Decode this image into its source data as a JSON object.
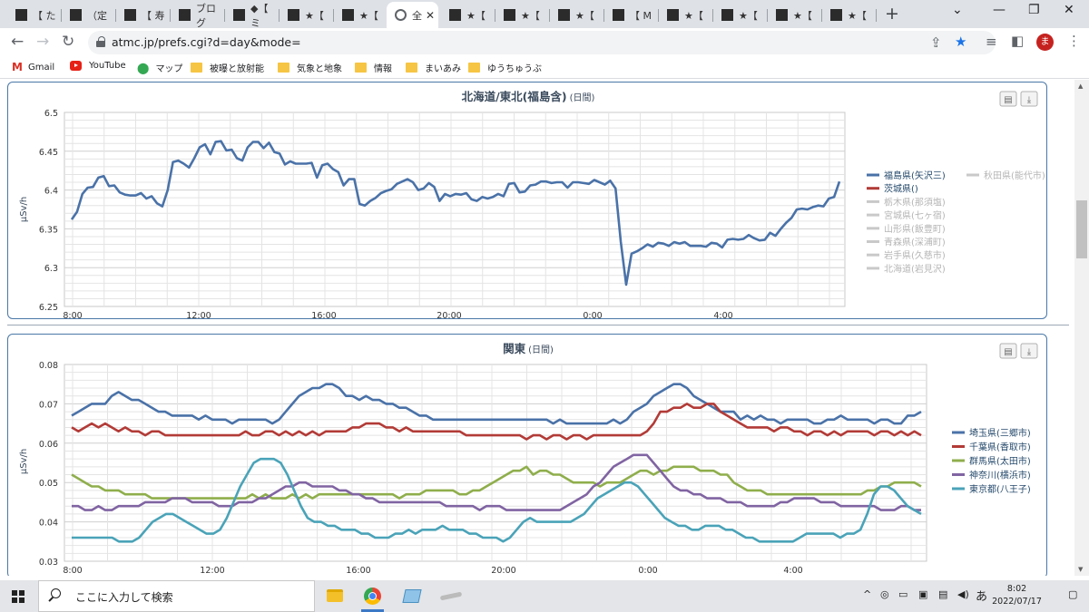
{
  "browser": {
    "tabs": [
      {
        "label": "【 た",
        "active": false
      },
      {
        "label": "（定",
        "active": false
      },
      {
        "label": "【 寿",
        "active": false
      },
      {
        "label": "ブログ",
        "active": false
      },
      {
        "label": "◆【 ミ",
        "active": false
      },
      {
        "label": "★【",
        "active": false
      },
      {
        "label": "★【",
        "active": false
      },
      {
        "label": "全",
        "active": true
      },
      {
        "label": "★【",
        "active": false
      },
      {
        "label": "★【",
        "active": false
      },
      {
        "label": "★【",
        "active": false
      },
      {
        "label": "【 M",
        "active": false
      },
      {
        "label": "★【",
        "active": false
      },
      {
        "label": "★【",
        "active": false
      },
      {
        "label": "★【",
        "active": false
      },
      {
        "label": "★【",
        "active": false
      }
    ],
    "url": "atmc.jp/prefs.cgi?d=day&mode=",
    "profile_initial": "ま",
    "bookmarks": [
      {
        "label": "Gmail",
        "icon": "gmail-icon"
      },
      {
        "label": "YouTube",
        "icon": "youtube-icon"
      },
      {
        "label": "マップ",
        "icon": "maps-icon"
      },
      {
        "label": "被曝と放射能",
        "icon": "folder-icon"
      },
      {
        "label": "気象と地象",
        "icon": "folder-icon"
      },
      {
        "label": "情報",
        "icon": "folder-icon"
      },
      {
        "label": "まいあみ",
        "icon": "folder-icon"
      },
      {
        "label": "ゆうちゅうぶ",
        "icon": "folder-icon"
      }
    ]
  },
  "taskbar": {
    "search_placeholder": "ここに入力して検索",
    "time": "8:02",
    "date": "2022/07/17",
    "ime": "あ"
  },
  "chart_data": [
    {
      "type": "line",
      "title": "北海道/東北(福島含)",
      "subtitle": "(日間)",
      "ylabel": "μSv/h",
      "ylim": [
        6.25,
        6.5
      ],
      "yticks": [
        "6.5",
        "6.45",
        "6.4",
        "6.35",
        "6.3",
        "6.25"
      ],
      "xticks": [
        "8:00",
        "12:00",
        "16:00",
        "20:00",
        "0:00",
        "4:00"
      ],
      "grid": true,
      "legend_position": "right",
      "series": [
        {
          "name": "福島県(矢沢三)",
          "color": "#4a72a8",
          "active": true,
          "values": [
            6.362,
            6.372,
            6.395,
            6.403,
            6.404,
            6.416,
            6.418,
            6.405,
            6.406,
            6.397,
            6.394,
            6.393,
            6.393,
            6.396,
            6.389,
            6.392,
            6.383,
            6.379,
            6.4,
            6.436,
            6.438,
            6.434,
            6.429,
            6.441,
            6.455,
            6.459,
            6.446,
            6.462,
            6.463,
            6.451,
            6.452,
            6.441,
            6.438,
            6.455,
            6.462,
            6.462,
            6.454,
            6.461,
            6.449,
            6.447,
            6.433,
            6.437,
            6.434,
            6.434,
            6.434,
            6.435,
            6.416,
            6.432,
            6.434,
            6.427,
            6.423,
            6.406,
            6.414,
            6.414,
            6.382,
            6.38,
            6.386,
            6.39,
            6.396,
            6.399,
            6.401,
            6.408,
            6.411,
            6.414,
            6.41,
            6.4,
            6.402,
            6.409,
            6.404,
            6.386,
            6.395,
            6.392,
            6.395,
            6.394,
            6.396,
            6.388,
            6.386,
            6.391,
            6.389,
            6.391,
            6.395,
            6.392,
            6.408,
            6.409,
            6.397,
            6.398,
            6.406,
            6.407,
            6.411,
            6.411,
            6.409,
            6.41,
            6.41,
            6.403,
            6.41,
            6.41,
            6.409,
            6.408,
            6.413,
            6.41,
            6.407,
            6.412,
            6.402,
            6.333,
            6.278,
            6.318,
            6.321,
            6.325,
            6.33,
            6.327,
            6.332,
            6.331,
            6.328,
            6.333,
            6.331,
            6.333,
            6.328,
            6.328,
            6.328,
            6.327,
            6.332,
            6.331,
            6.326,
            6.336,
            6.337,
            6.336,
            6.337,
            6.342,
            6.338,
            6.335,
            6.336,
            6.345,
            6.341,
            6.35,
            6.358,
            6.364,
            6.375,
            6.376,
            6.375,
            6.378,
            6.38,
            6.379,
            6.389,
            6.391,
            6.411
          ]
        },
        {
          "name": "秋田県(能代市)",
          "color": "#c9c9c9",
          "active": false,
          "values": []
        },
        {
          "name": "茨城県()",
          "color": "#b23b37",
          "active": true,
          "values": []
        },
        {
          "name": "栃木県(那須塩)",
          "color": "#c9c9c9",
          "active": false,
          "values": []
        },
        {
          "name": "宮城県(七ヶ宿)",
          "color": "#c9c9c9",
          "active": false,
          "values": []
        },
        {
          "name": "山形県(飯豊町)",
          "color": "#c9c9c9",
          "active": false,
          "values": []
        },
        {
          "name": "青森県(深浦町)",
          "color": "#c9c9c9",
          "active": false,
          "values": []
        },
        {
          "name": "岩手県(久慈市)",
          "color": "#c9c9c9",
          "active": false,
          "values": []
        },
        {
          "name": "北海道(岩見沢)",
          "color": "#c9c9c9",
          "active": false,
          "values": []
        }
      ]
    },
    {
      "type": "line",
      "title": "関東",
      "subtitle": "(日間)",
      "ylabel": "μSv/h",
      "ylim": [
        0.03,
        0.08
      ],
      "yticks": [
        "0.08",
        "0.07",
        "0.06",
        "0.05",
        "0.04",
        "0.03"
      ],
      "xticks": [
        "8:00",
        "12:00",
        "16:00",
        "20:00",
        "0:00",
        "4:00"
      ],
      "grid": true,
      "legend_position": "right",
      "series": [
        {
          "name": "埼玉県(三郷市)",
          "color": "#4a72a8",
          "active": true,
          "values": [
            0.067,
            0.068,
            0.069,
            0.07,
            0.07,
            0.07,
            0.072,
            0.073,
            0.072,
            0.071,
            0.071,
            0.07,
            0.069,
            0.068,
            0.068,
            0.067,
            0.067,
            0.067,
            0.067,
            0.066,
            0.067,
            0.066,
            0.066,
            0.066,
            0.065,
            0.066,
            0.066,
            0.066,
            0.066,
            0.066,
            0.065,
            0.066,
            0.068,
            0.07,
            0.072,
            0.073,
            0.074,
            0.074,
            0.075,
            0.075,
            0.074,
            0.072,
            0.072,
            0.071,
            0.072,
            0.071,
            0.071,
            0.07,
            0.07,
            0.069,
            0.069,
            0.068,
            0.067,
            0.067,
            0.066,
            0.066,
            0.066,
            0.066,
            0.066,
            0.066,
            0.066,
            0.066,
            0.066,
            0.066,
            0.066,
            0.066,
            0.066,
            0.066,
            0.066,
            0.066,
            0.066,
            0.066,
            0.065,
            0.066,
            0.065,
            0.065,
            0.065,
            0.065,
            0.065,
            0.065,
            0.065,
            0.066,
            0.065,
            0.066,
            0.068,
            0.069,
            0.07,
            0.072,
            0.073,
            0.074,
            0.075,
            0.075,
            0.074,
            0.072,
            0.071,
            0.07,
            0.069,
            0.068,
            0.068,
            0.068,
            0.066,
            0.067,
            0.066,
            0.067,
            0.066,
            0.066,
            0.065,
            0.066,
            0.066,
            0.066,
            0.066,
            0.065,
            0.065,
            0.066,
            0.066,
            0.067,
            0.066,
            0.066,
            0.066,
            0.066,
            0.065,
            0.066,
            0.066,
            0.065,
            0.065,
            0.067,
            0.067,
            0.068
          ]
        },
        {
          "name": "千葉県(香取市)",
          "color": "#b23b37",
          "active": true,
          "values": [
            0.064,
            0.063,
            0.064,
            0.065,
            0.064,
            0.065,
            0.064,
            0.063,
            0.064,
            0.063,
            0.063,
            0.062,
            0.063,
            0.063,
            0.062,
            0.062,
            0.062,
            0.062,
            0.062,
            0.062,
            0.062,
            0.062,
            0.062,
            0.062,
            0.062,
            0.062,
            0.063,
            0.062,
            0.062,
            0.063,
            0.063,
            0.062,
            0.063,
            0.062,
            0.063,
            0.062,
            0.063,
            0.062,
            0.063,
            0.063,
            0.063,
            0.063,
            0.064,
            0.064,
            0.065,
            0.065,
            0.065,
            0.064,
            0.064,
            0.063,
            0.064,
            0.063,
            0.063,
            0.063,
            0.063,
            0.063,
            0.063,
            0.063,
            0.063,
            0.062,
            0.062,
            0.062,
            0.062,
            0.062,
            0.062,
            0.062,
            0.062,
            0.062,
            0.061,
            0.062,
            0.062,
            0.061,
            0.062,
            0.062,
            0.061,
            0.062,
            0.062,
            0.061,
            0.062,
            0.062,
            0.062,
            0.062,
            0.062,
            0.062,
            0.062,
            0.062,
            0.063,
            0.065,
            0.068,
            0.068,
            0.069,
            0.069,
            0.07,
            0.069,
            0.069,
            0.07,
            0.07,
            0.068,
            0.067,
            0.066,
            0.065,
            0.064,
            0.064,
            0.064,
            0.064,
            0.063,
            0.064,
            0.064,
            0.063,
            0.063,
            0.062,
            0.063,
            0.063,
            0.062,
            0.063,
            0.062,
            0.063,
            0.063,
            0.063,
            0.063,
            0.062,
            0.063,
            0.063,
            0.062,
            0.063,
            0.062,
            0.063,
            0.062
          ]
        },
        {
          "name": "群馬県(太田市)",
          "color": "#8fae4c",
          "active": true,
          "values": [
            0.052,
            0.051,
            0.05,
            0.049,
            0.049,
            0.048,
            0.048,
            0.048,
            0.047,
            0.047,
            0.047,
            0.047,
            0.046,
            0.046,
            0.046,
            0.046,
            0.046,
            0.046,
            0.046,
            0.046,
            0.046,
            0.046,
            0.046,
            0.046,
            0.046,
            0.046,
            0.046,
            0.047,
            0.046,
            0.047,
            0.046,
            0.046,
            0.046,
            0.047,
            0.046,
            0.047,
            0.046,
            0.047,
            0.047,
            0.047,
            0.047,
            0.047,
            0.047,
            0.047,
            0.047,
            0.047,
            0.047,
            0.047,
            0.047,
            0.046,
            0.047,
            0.047,
            0.047,
            0.048,
            0.048,
            0.048,
            0.048,
            0.048,
            0.047,
            0.047,
            0.048,
            0.048,
            0.049,
            0.05,
            0.051,
            0.052,
            0.053,
            0.053,
            0.054,
            0.052,
            0.053,
            0.053,
            0.052,
            0.052,
            0.051,
            0.05,
            0.05,
            0.05,
            0.05,
            0.049,
            0.05,
            0.05,
            0.05,
            0.051,
            0.052,
            0.053,
            0.053,
            0.052,
            0.053,
            0.053,
            0.054,
            0.054,
            0.054,
            0.054,
            0.053,
            0.053,
            0.053,
            0.052,
            0.052,
            0.05,
            0.049,
            0.048,
            0.048,
            0.048,
            0.047,
            0.047,
            0.047,
            0.047,
            0.047,
            0.047,
            0.047,
            0.047,
            0.047,
            0.047,
            0.047,
            0.047,
            0.047,
            0.047,
            0.047,
            0.048,
            0.048,
            0.049,
            0.049,
            0.05,
            0.05,
            0.05,
            0.05,
            0.049
          ]
        },
        {
          "name": "神奈川(横浜市)",
          "color": "#8064a2",
          "active": true,
          "values": [
            0.044,
            0.044,
            0.043,
            0.043,
            0.044,
            0.043,
            0.043,
            0.044,
            0.044,
            0.044,
            0.044,
            0.045,
            0.045,
            0.045,
            0.045,
            0.046,
            0.046,
            0.046,
            0.045,
            0.045,
            0.045,
            0.045,
            0.044,
            0.044,
            0.044,
            0.045,
            0.045,
            0.045,
            0.046,
            0.046,
            0.047,
            0.048,
            0.049,
            0.049,
            0.05,
            0.05,
            0.049,
            0.049,
            0.049,
            0.049,
            0.048,
            0.048,
            0.047,
            0.047,
            0.046,
            0.046,
            0.045,
            0.045,
            0.045,
            0.045,
            0.045,
            0.045,
            0.045,
            0.045,
            0.045,
            0.045,
            0.044,
            0.044,
            0.044,
            0.044,
            0.044,
            0.043,
            0.044,
            0.044,
            0.044,
            0.043,
            0.043,
            0.043,
            0.043,
            0.043,
            0.043,
            0.043,
            0.043,
            0.043,
            0.044,
            0.045,
            0.046,
            0.047,
            0.049,
            0.05,
            0.052,
            0.054,
            0.055,
            0.056,
            0.057,
            0.057,
            0.057,
            0.055,
            0.053,
            0.051,
            0.049,
            0.048,
            0.048,
            0.047,
            0.047,
            0.046,
            0.046,
            0.046,
            0.045,
            0.045,
            0.045,
            0.044,
            0.044,
            0.044,
            0.044,
            0.044,
            0.045,
            0.045,
            0.046,
            0.046,
            0.046,
            0.046,
            0.045,
            0.045,
            0.045,
            0.044,
            0.044,
            0.044,
            0.044,
            0.044,
            0.044,
            0.043,
            0.043,
            0.043,
            0.044,
            0.044,
            0.043,
            0.043
          ]
        },
        {
          "name": "東京都(八王子)",
          "color": "#4aa3b8",
          "active": true,
          "values": [
            0.036,
            0.036,
            0.036,
            0.036,
            0.036,
            0.036,
            0.036,
            0.035,
            0.035,
            0.035,
            0.036,
            0.038,
            0.04,
            0.041,
            0.042,
            0.042,
            0.041,
            0.04,
            0.039,
            0.038,
            0.037,
            0.037,
            0.038,
            0.041,
            0.045,
            0.049,
            0.052,
            0.055,
            0.056,
            0.056,
            0.056,
            0.055,
            0.052,
            0.048,
            0.044,
            0.041,
            0.04,
            0.04,
            0.039,
            0.039,
            0.038,
            0.038,
            0.038,
            0.037,
            0.037,
            0.036,
            0.036,
            0.036,
            0.037,
            0.037,
            0.038,
            0.037,
            0.038,
            0.038,
            0.038,
            0.039,
            0.038,
            0.038,
            0.038,
            0.037,
            0.037,
            0.036,
            0.036,
            0.036,
            0.035,
            0.036,
            0.038,
            0.04,
            0.041,
            0.04,
            0.04,
            0.04,
            0.04,
            0.04,
            0.04,
            0.041,
            0.042,
            0.044,
            0.046,
            0.047,
            0.048,
            0.049,
            0.05,
            0.05,
            0.049,
            0.047,
            0.045,
            0.043,
            0.041,
            0.04,
            0.039,
            0.039,
            0.038,
            0.038,
            0.039,
            0.039,
            0.039,
            0.038,
            0.038,
            0.037,
            0.036,
            0.036,
            0.035,
            0.035,
            0.035,
            0.035,
            0.035,
            0.035,
            0.036,
            0.037,
            0.037,
            0.037,
            0.037,
            0.037,
            0.036,
            0.037,
            0.037,
            0.038,
            0.042,
            0.047,
            0.049,
            0.049,
            0.048,
            0.046,
            0.044,
            0.043,
            0.042
          ]
        }
      ]
    }
  ]
}
